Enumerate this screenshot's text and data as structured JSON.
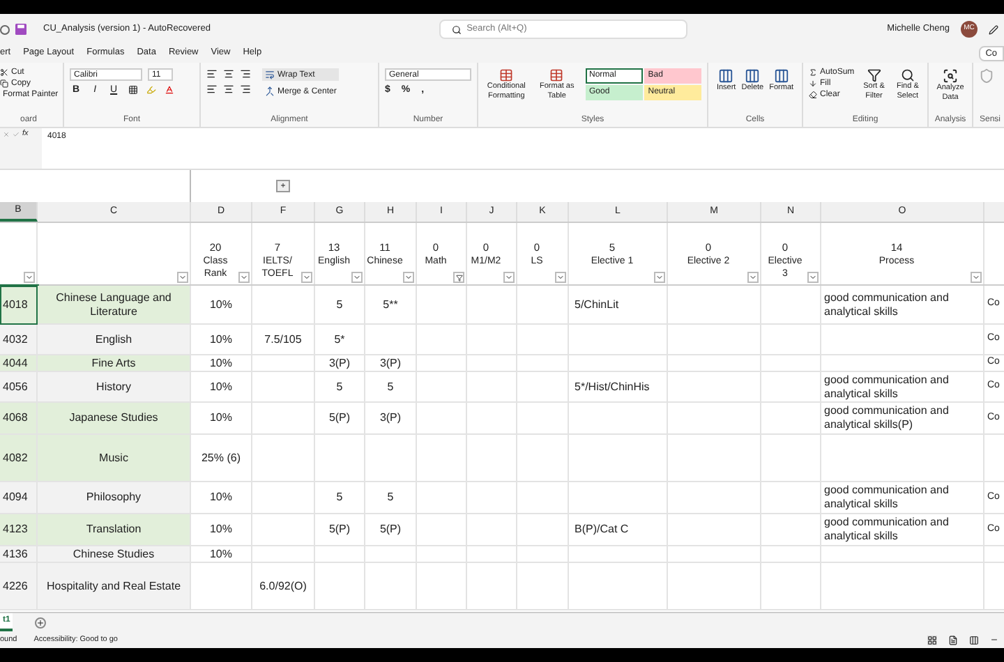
{
  "title_bar": {
    "document": "CU_Analysis (version 1)  -  AutoRecovered",
    "search": {
      "placeholder": "Search (Alt+Q)"
    },
    "user": "Michelle Cheng",
    "avatar": "MC"
  },
  "menu": [
    "ert",
    "Page Layout",
    "Formulas",
    "Data",
    "Review",
    "View",
    "Help"
  ],
  "comments_button": "Co",
  "ribbon": [
    {
      "kind": "clipboard",
      "label": "oard",
      "items": [
        "Cut",
        "Copy",
        "Format Painter"
      ]
    },
    {
      "kind": "font",
      "label": "Font",
      "font": "Calibri",
      "size": "11",
      "buttons": [
        "B",
        "I",
        "U"
      ]
    },
    {
      "kind": "alignment",
      "label": "Alignment",
      "items": [
        "Wrap Text",
        "Merge & Center"
      ]
    },
    {
      "kind": "number",
      "label": "Number",
      "format": "General",
      "buttons": [
        "$",
        "%",
        ","
      ]
    },
    {
      "kind": "styles",
      "label": "Styles",
      "items": [
        "Conditional Formatting",
        "Format as Table"
      ],
      "styles": [
        {
          "label": "Normal",
          "color": "#ffffff",
          "selected": true
        },
        {
          "label": "Bad",
          "color": "#ffc7ce",
          "selected": false
        },
        {
          "label": "Good",
          "color": "#c6efce",
          "selected": false
        },
        {
          "label": "Neutral",
          "color": "#ffeb9c",
          "selected": false
        }
      ]
    },
    {
      "kind": "cells",
      "label": "Cells",
      "items": [
        "Insert",
        "Delete",
        "Format"
      ]
    },
    {
      "kind": "editing",
      "label": "Editing",
      "small": [
        "AutoSum",
        "Fill",
        "Clear"
      ],
      "items": [
        "Sort & Filter",
        "Find & Select"
      ]
    },
    {
      "kind": "analysis",
      "label": "Analysis",
      "items": [
        "Analyze Data"
      ]
    },
    {
      "kind": "sensitivity",
      "label": "Sensi"
    }
  ],
  "formula_bar": {
    "label": "fx",
    "value": "4018"
  },
  "group_button": "+",
  "columns": [
    {
      "letter": "B",
      "selected": true,
      "filtered": false
    },
    {
      "letter": "C",
      "selected": false,
      "filtered": false
    },
    {
      "letter": "D",
      "count": "20",
      "label": "Class Rank",
      "selected": false,
      "filtered": false
    },
    {
      "letter": "F",
      "count": "7",
      "label": "IELTS/ TOEFL",
      "selected": false,
      "filtered": false
    },
    {
      "letter": "G",
      "count": "13",
      "label": "English",
      "selected": false,
      "filtered": false
    },
    {
      "letter": "H",
      "count": "11",
      "label": "Chinese",
      "selected": false,
      "filtered": false
    },
    {
      "letter": "I",
      "count": "0",
      "label": "Math",
      "selected": false,
      "filtered": true
    },
    {
      "letter": "J",
      "count": "0",
      "label": "M1/M2",
      "selected": false,
      "filtered": false
    },
    {
      "letter": "K",
      "count": "0",
      "label": "LS",
      "selected": false,
      "filtered": false
    },
    {
      "letter": "L",
      "count": "5",
      "label": "Elective 1",
      "selected": false,
      "filtered": false
    },
    {
      "letter": "M",
      "count": "0",
      "label": "Elective 2",
      "selected": false,
      "filtered": false
    },
    {
      "letter": "N",
      "count": "0",
      "label": "Elective 3",
      "selected": false,
      "filtered": false
    },
    {
      "letter": "O",
      "count": "14",
      "label": "Process",
      "selected": false,
      "filtered": false
    }
  ],
  "rows": [
    {
      "code": "4018",
      "subject": "Chinese Language and Literature",
      "highlighted": true,
      "selected": true,
      "cells": {
        "D": "10%",
        "G": "5",
        "H": "5**",
        "L": "5/ChinLit",
        "O": "good communication and analytical skills"
      },
      "last_column": "Co"
    },
    {
      "code": "4032",
      "subject": "English",
      "highlighted": false,
      "selected": false,
      "cells": {
        "D": "10%",
        "F": "7.5/105",
        "G": "5*"
      },
      "last_column": "Co"
    },
    {
      "code": "4044",
      "subject": "Fine Arts",
      "highlighted": true,
      "selected": false,
      "cells": {
        "D": "10%",
        "G": "3(P)",
        "H": "3(P)"
      },
      "last_column": "Co"
    },
    {
      "code": "4056",
      "subject": "History",
      "highlighted": false,
      "selected": false,
      "cells": {
        "D": "10%",
        "G": "5",
        "H": "5",
        "L": "5*/Hist/ChinHis",
        "O": "good communication and analytical skills"
      },
      "last_column": "Co"
    },
    {
      "code": "4068",
      "subject": "Japanese Studies",
      "highlighted": true,
      "selected": false,
      "cells": {
        "D": "10%",
        "G": "5(P)",
        "H": "3(P)",
        "O": "good communication and analytical skills(P)"
      },
      "last_column": "Co"
    },
    {
      "code": "4082",
      "subject": "Music",
      "highlighted": true,
      "selected": false,
      "cells": {
        "D": "25% (6)"
      }
    },
    {
      "code": "4094",
      "subject": "Philosophy",
      "highlighted": false,
      "selected": false,
      "cells": {
        "D": "10%",
        "G": "5",
        "H": "5",
        "O": "good communication and analytical skills"
      },
      "last_column": "Co"
    },
    {
      "code": "4123",
      "subject": "Translation",
      "highlighted": true,
      "selected": false,
      "cells": {
        "D": "10%",
        "G": "5(P)",
        "H": "5(P)",
        "L": "B(P)/Cat C",
        "O": "good communication and analytical skills"
      },
      "last_column": "Co"
    },
    {
      "code": "4136",
      "subject": "Chinese Studies",
      "highlighted": false,
      "selected": false,
      "cells": {
        "D": "10%"
      }
    },
    {
      "code": "4226",
      "subject": "Hospitality and Real Estate",
      "highlighted": false,
      "selected": false,
      "cells": {
        "F": "6.0/92(O)"
      }
    }
  ],
  "sheet_tabs": [
    {
      "label": "t1",
      "selected": true
    }
  ],
  "status": [
    "ound",
    "Accessibility: Good to go"
  ]
}
